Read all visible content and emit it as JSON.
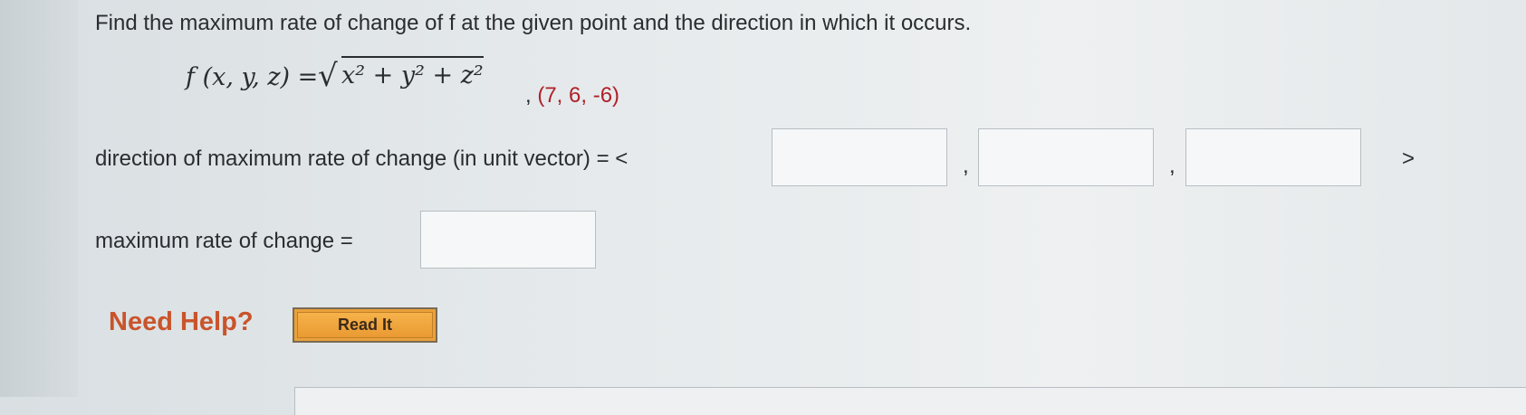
{
  "question": {
    "text": "Find the maximum rate of change of f at the given point and the direction in which it occurs."
  },
  "function": {
    "lhs": "f (x, y, z) =",
    "sqrt_symbol": "√",
    "radicand": "x² + y² + z²",
    "point": "(7, 6, -6)"
  },
  "direction": {
    "label": "direction of maximum rate of change (in unit vector) =",
    "open_bracket": "<",
    "close_bracket": ">",
    "separator": ",",
    "values": [
      "",
      "",
      ""
    ]
  },
  "rate": {
    "label": "maximum rate of change =",
    "value": ""
  },
  "help": {
    "label": "Need Help?",
    "read_it": "Read It"
  },
  "colors": {
    "point_red": "#b0202a",
    "need_help_orange": "#c9542b",
    "button_orange": "#ea9a32"
  }
}
